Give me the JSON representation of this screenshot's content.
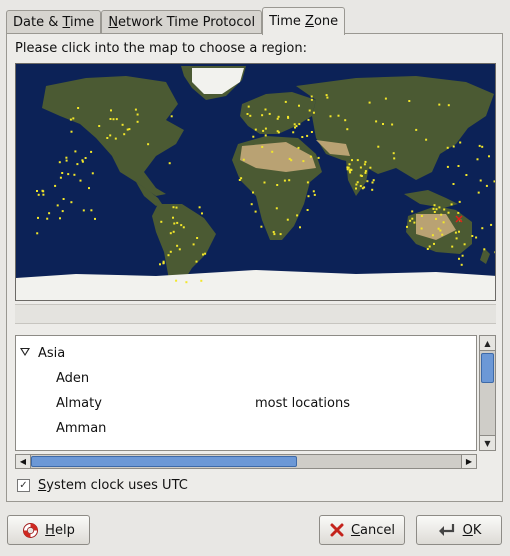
{
  "tabs": [
    {
      "label": "Date & Time",
      "pre": "Date & ",
      "mnemonic": "T",
      "post": "ime",
      "active": false
    },
    {
      "label": "Network Time Protocol",
      "pre": "",
      "mnemonic": "N",
      "post": "etwork Time Protocol",
      "active": false
    },
    {
      "label": "Time Zone",
      "pre": "Time ",
      "mnemonic": "Z",
      "post": "one",
      "active": true
    }
  ],
  "prompt": "Please click into the map to choose a region:",
  "map": {
    "ocean_color": "#0c2257",
    "land_color": "#4b5a33",
    "desert_color": "#b9a273",
    "ice_color": "#f2f2ee",
    "city_color": "#f2e72a",
    "selected_marker_color": "#e0201a"
  },
  "timezones": {
    "group": "Asia",
    "rows": [
      {
        "name": "Aden",
        "comment": ""
      },
      {
        "name": "Almaty",
        "comment": "most locations"
      },
      {
        "name": "Amman",
        "comment": ""
      }
    ]
  },
  "utc": {
    "pre": "",
    "mnemonic": "S",
    "post": "ystem clock uses UTC",
    "checked": true,
    "check_glyph": "✓"
  },
  "buttons": {
    "help": {
      "pre": "",
      "mnemonic": "H",
      "post": "elp",
      "icon": "lifebuoy-icon"
    },
    "cancel": {
      "pre": "",
      "mnemonic": "C",
      "post": "ancel",
      "icon": "cancel-x-icon"
    },
    "ok": {
      "pre": "",
      "mnemonic": "O",
      "post": "K",
      "icon": "ok-return-arrow-icon"
    }
  },
  "scroll_arrows": {
    "up": "▲",
    "down": "▼",
    "left": "◀",
    "right": "▶"
  }
}
